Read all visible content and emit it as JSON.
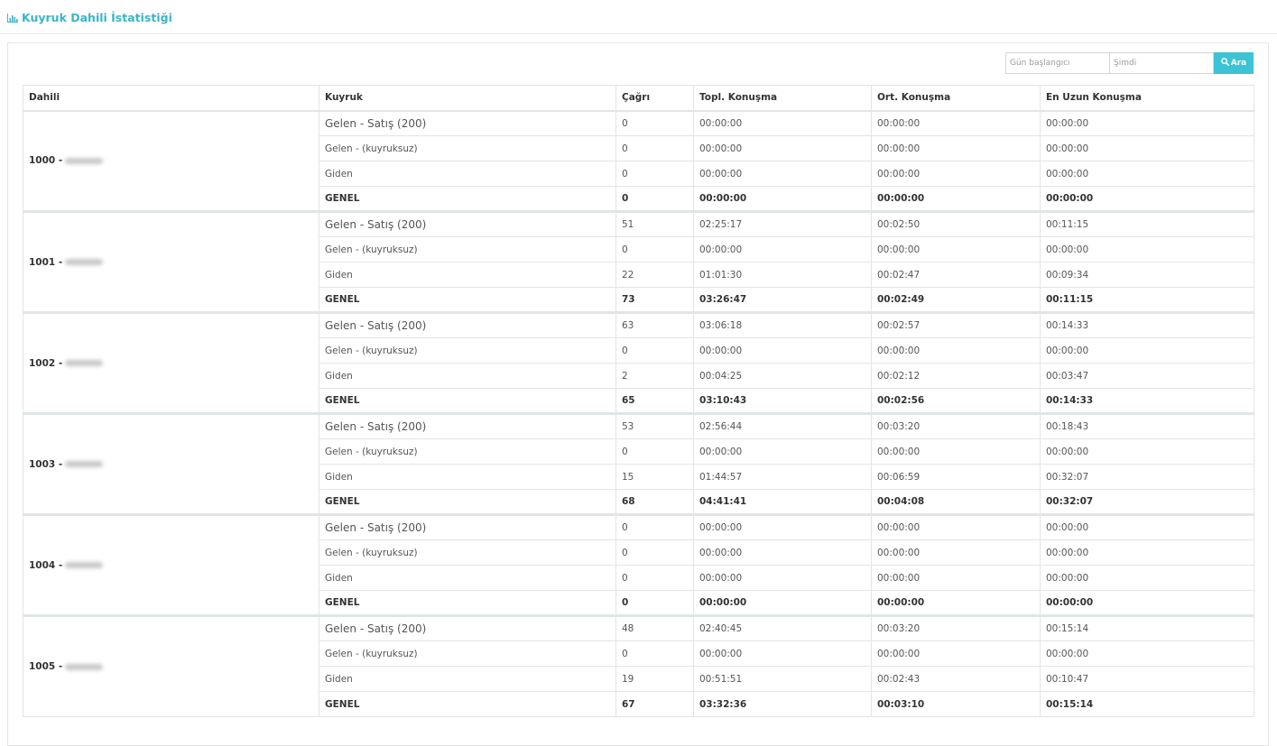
{
  "page": {
    "title": "Kuyruk Dahili İstatistiği",
    "title_icon": "bar-chart-icon",
    "accent_color": "#3cb4c8"
  },
  "search": {
    "start_placeholder": "Gün başlangıcı",
    "end_placeholder": "Şimdi",
    "button_label": "Ara",
    "button_icon": "search-icon",
    "button_color": "#3cc3d5"
  },
  "table": {
    "headers": [
      "Dahili",
      "Kuyruk",
      "Çağrı",
      "Topl. Konuşma",
      "Ort. Konuşma",
      "En Uzun Konuşma"
    ],
    "groups": [
      {
        "dahili": "1000 -",
        "rows": [
          {
            "queue": "Gelen - Satış (200)",
            "calls": "0",
            "total": "00:00:00",
            "avg": "00:00:00",
            "max": "00:00:00"
          },
          {
            "queue": "Gelen - (kuyruksuz)",
            "calls": "0",
            "total": "00:00:00",
            "avg": "00:00:00",
            "max": "00:00:00"
          },
          {
            "queue": "Giden",
            "calls": "0",
            "total": "00:00:00",
            "avg": "00:00:00",
            "max": "00:00:00"
          },
          {
            "queue": "GENEL",
            "calls": "0",
            "total": "00:00:00",
            "avg": "00:00:00",
            "max": "00:00:00"
          }
        ]
      },
      {
        "dahili": "1001 -",
        "rows": [
          {
            "queue": "Gelen - Satış (200)",
            "calls": "51",
            "total": "02:25:17",
            "avg": "00:02:50",
            "max": "00:11:15"
          },
          {
            "queue": "Gelen - (kuyruksuz)",
            "calls": "0",
            "total": "00:00:00",
            "avg": "00:00:00",
            "max": "00:00:00"
          },
          {
            "queue": "Giden",
            "calls": "22",
            "total": "01:01:30",
            "avg": "00:02:47",
            "max": "00:09:34"
          },
          {
            "queue": "GENEL",
            "calls": "73",
            "total": "03:26:47",
            "avg": "00:02:49",
            "max": "00:11:15"
          }
        ]
      },
      {
        "dahili": "1002 -",
        "rows": [
          {
            "queue": "Gelen - Satış (200)",
            "calls": "63",
            "total": "03:06:18",
            "avg": "00:02:57",
            "max": "00:14:33"
          },
          {
            "queue": "Gelen - (kuyruksuz)",
            "calls": "0",
            "total": "00:00:00",
            "avg": "00:00:00",
            "max": "00:00:00"
          },
          {
            "queue": "Giden",
            "calls": "2",
            "total": "00:04:25",
            "avg": "00:02:12",
            "max": "00:03:47"
          },
          {
            "queue": "GENEL",
            "calls": "65",
            "total": "03:10:43",
            "avg": "00:02:56",
            "max": "00:14:33"
          }
        ]
      },
      {
        "dahili": "1003 -",
        "rows": [
          {
            "queue": "Gelen - Satış (200)",
            "calls": "53",
            "total": "02:56:44",
            "avg": "00:03:20",
            "max": "00:18:43"
          },
          {
            "queue": "Gelen - (kuyruksuz)",
            "calls": "0",
            "total": "00:00:00",
            "avg": "00:00:00",
            "max": "00:00:00"
          },
          {
            "queue": "Giden",
            "calls": "15",
            "total": "01:44:57",
            "avg": "00:06:59",
            "max": "00:32:07"
          },
          {
            "queue": "GENEL",
            "calls": "68",
            "total": "04:41:41",
            "avg": "00:04:08",
            "max": "00:32:07"
          }
        ]
      },
      {
        "dahili": "1004 -",
        "rows": [
          {
            "queue": "Gelen - Satış (200)",
            "calls": "0",
            "total": "00:00:00",
            "avg": "00:00:00",
            "max": "00:00:00"
          },
          {
            "queue": "Gelen - (kuyruksuz)",
            "calls": "0",
            "total": "00:00:00",
            "avg": "00:00:00",
            "max": "00:00:00"
          },
          {
            "queue": "Giden",
            "calls": "0",
            "total": "00:00:00",
            "avg": "00:00:00",
            "max": "00:00:00"
          },
          {
            "queue": "GENEL",
            "calls": "0",
            "total": "00:00:00",
            "avg": "00:00:00",
            "max": "00:00:00"
          }
        ]
      },
      {
        "dahili": "1005 -",
        "rows": [
          {
            "queue": "Gelen - Satış (200)",
            "calls": "48",
            "total": "02:40:45",
            "avg": "00:03:20",
            "max": "00:15:14"
          },
          {
            "queue": "Gelen - (kuyruksuz)",
            "calls": "0",
            "total": "00:00:00",
            "avg": "00:00:00",
            "max": "00:00:00"
          },
          {
            "queue": "Giden",
            "calls": "19",
            "total": "00:51:51",
            "avg": "00:02:43",
            "max": "00:10:47"
          },
          {
            "queue": "GENEL",
            "calls": "67",
            "total": "03:32:36",
            "avg": "00:03:10",
            "max": "00:15:14"
          }
        ]
      }
    ]
  }
}
